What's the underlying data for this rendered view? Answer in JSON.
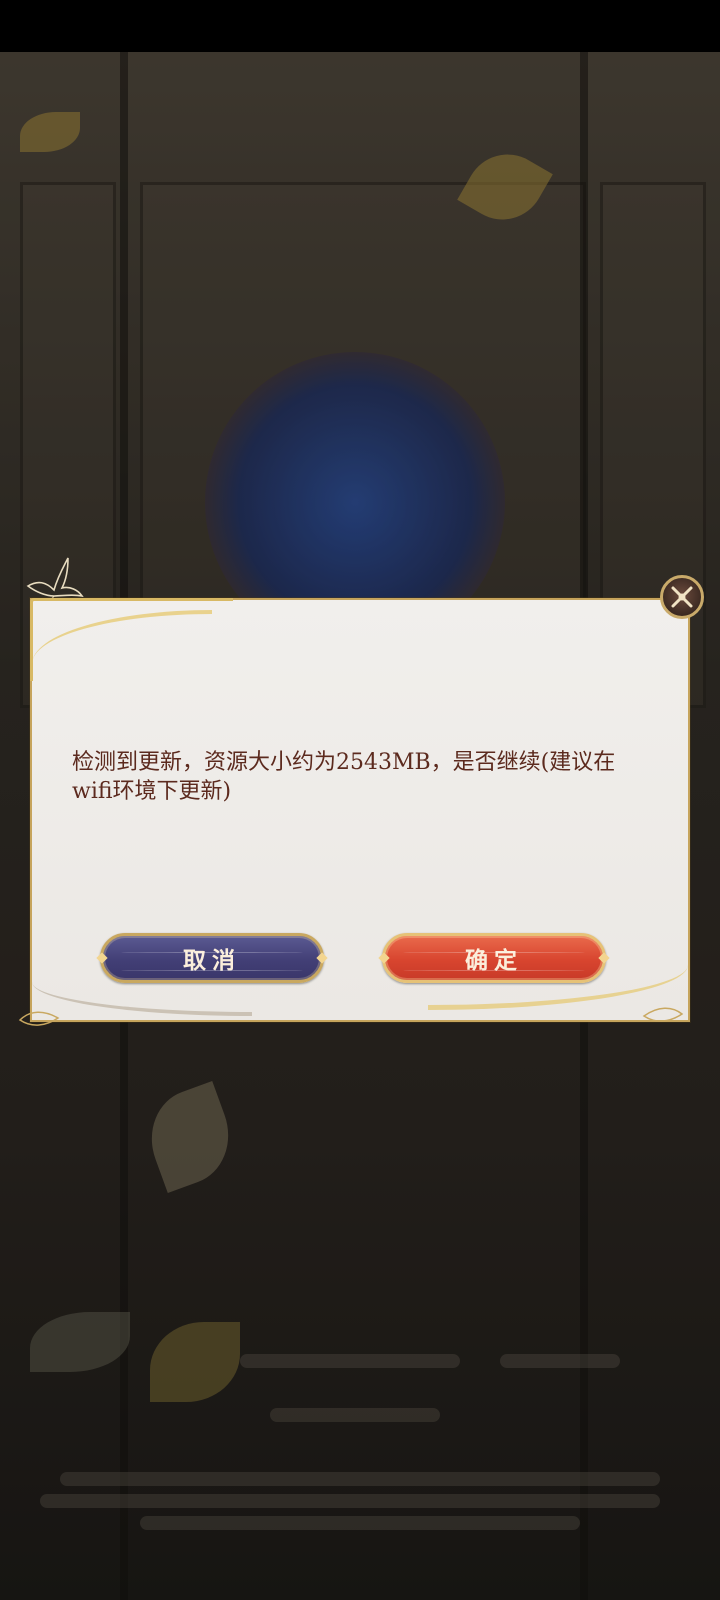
{
  "dialog": {
    "message": "检测到更新，资源大小约为2543MB，是否继续(建议在wifi环境下更新)",
    "cancel_label": "取消",
    "confirm_label": "确定",
    "close_icon": "close-icon"
  },
  "colors": {
    "message_text": "#5c2a1e",
    "cancel_button": "#423f76",
    "confirm_button": "#d8452f",
    "gold_trim": "#c9a860"
  }
}
